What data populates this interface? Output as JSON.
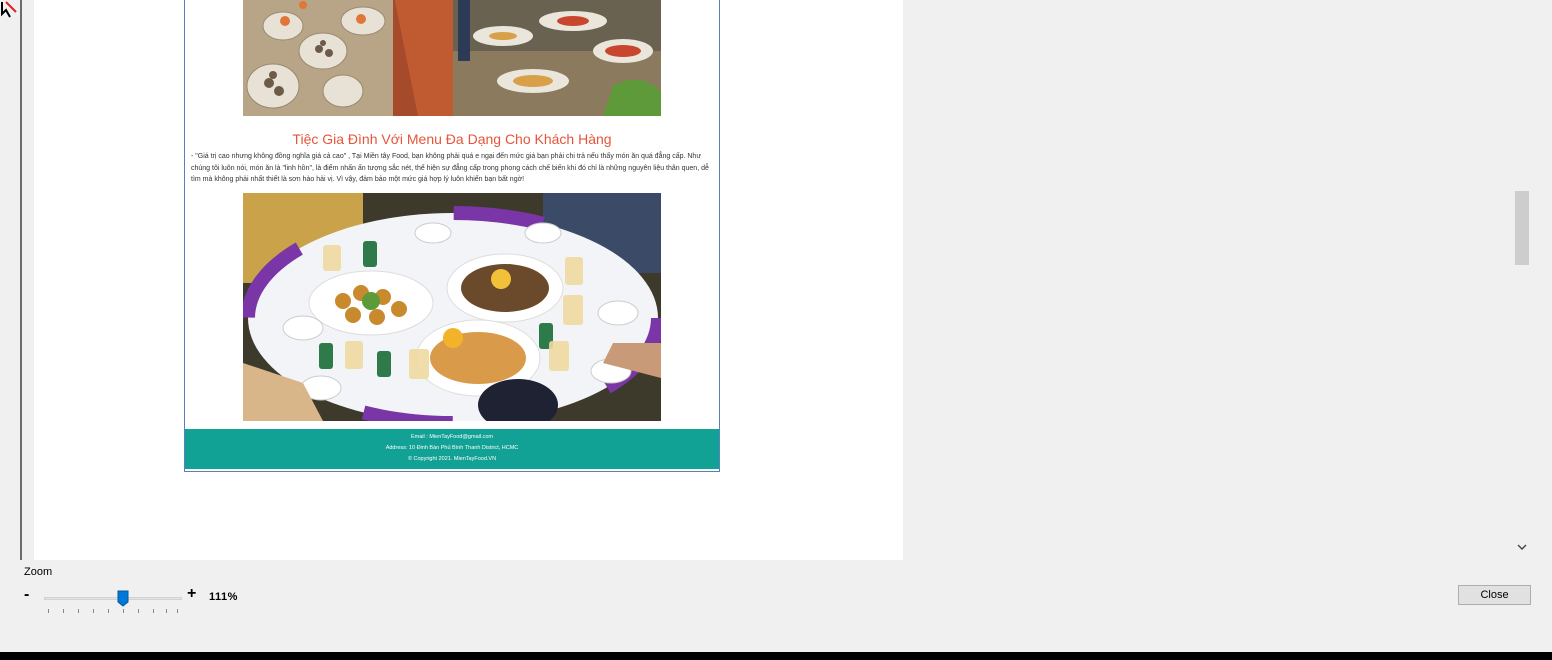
{
  "document": {
    "heading": "Tiệc Gia Đình Với Menu Đa Dạng Cho Khách Hàng",
    "paragraph": "- \"Giá trị cao nhưng không đồng nghĩa giá cả cao\" , Tại Miền tây Food, bạn không phải quá e ngại đến mức giá bạn phải chi trả nếu thấy món ăn quá đẳng cấp. Như chúng tôi luôn nói, món ăn là \"linh hồn\", là điểm nhấn ấn tượng sắc nét, thể hiện sự đẳng cấp trong phong cách chế biến khi đó chỉ là những nguyên liệu thân quen, dễ tìm mà không phải nhất thiết là sơn hào hải vị. Vì vậy, đảm bảo một mức giá hợp lý luôn khiến bạn bất ngờ!",
    "footer": {
      "email": "Email : MienTayFood@gmail.com",
      "address": "Address: 10 Đinh Bàn Phủ Bình Thanh District, HCMC",
      "copyright": "© Copyright 2021. MienTayFood.VN"
    }
  },
  "zoom": {
    "label": "Zoom",
    "minus": "-",
    "plus": "+",
    "value": "111%",
    "level_fraction": 0.58
  },
  "buttons": {
    "close": "Close"
  },
  "scrollbar": {
    "position_fraction": 0.41
  },
  "icons": {
    "scroll_down": "chevron-down-icon"
  },
  "colors": {
    "heading": "#e5553a",
    "footer_bg": "#12a195",
    "slider_thumb": "#0078d7"
  }
}
